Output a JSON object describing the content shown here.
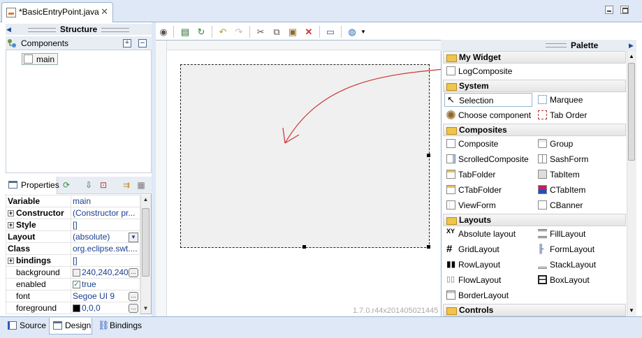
{
  "editor": {
    "tab_label": "*BasicEntryPoint.java",
    "close_glyph": "✕"
  },
  "structure": {
    "title": "Structure",
    "components_label": "Components",
    "tree": [
      {
        "label": "main"
      }
    ]
  },
  "properties": {
    "tab_label": "Properties",
    "rows": [
      {
        "key": "Variable",
        "value": "main"
      },
      {
        "key": "Constructor",
        "value": "(Constructor pr..."
      },
      {
        "key": "Style",
        "value": "[]"
      },
      {
        "key": "Layout",
        "value": "(absolute)"
      },
      {
        "key": "Class",
        "value": "org.eclipse.swt...."
      },
      {
        "key": "bindings",
        "value": "[]"
      },
      {
        "key": "background",
        "value": "240,240,240"
      },
      {
        "key": "enabled",
        "value": "true"
      },
      {
        "key": "font",
        "value": "Segoe UI 9"
      },
      {
        "key": "foreground",
        "value": "0,0,0"
      }
    ]
  },
  "canvas": {
    "version": "1.7.0.r44x201405021445"
  },
  "palette": {
    "title": "Palette",
    "categories": {
      "my_widget": "My Widget",
      "system": "System",
      "composites": "Composites",
      "layouts": "Layouts",
      "controls": "Controls"
    },
    "items": {
      "logcomposite": "LogComposite",
      "selection": "Selection",
      "marquee": "Marquee",
      "choose_component": "Choose component",
      "tab_order": "Tab Order",
      "composite": "Composite",
      "group": "Group",
      "scrolledcomposite": "ScrolledComposite",
      "sashform": "SashForm",
      "tabfolder": "TabFolder",
      "tabitem": "TabItem",
      "ctabfolder": "CTabFolder",
      "ctabitem": "CTabItem",
      "viewform": "ViewForm",
      "cbanner": "CBanner",
      "absolute_layout": "Absolute layout",
      "filllayout": "FillLayout",
      "gridlayout": "GridLayout",
      "formlayout": "FormLayout",
      "rowlayout": "RowLayout",
      "stacklayout": "StackLayout",
      "flowlayout": "FlowLayout",
      "boxlayout": "BoxLayout",
      "borderlayout": "BorderLayout"
    }
  },
  "bottom_tabs": {
    "source": "Source",
    "design": "Design",
    "bindings": "Bindings"
  },
  "colors": {
    "accent": "#dfe8f6",
    "border": "#99b4d1",
    "arrow": "#cc3333"
  }
}
